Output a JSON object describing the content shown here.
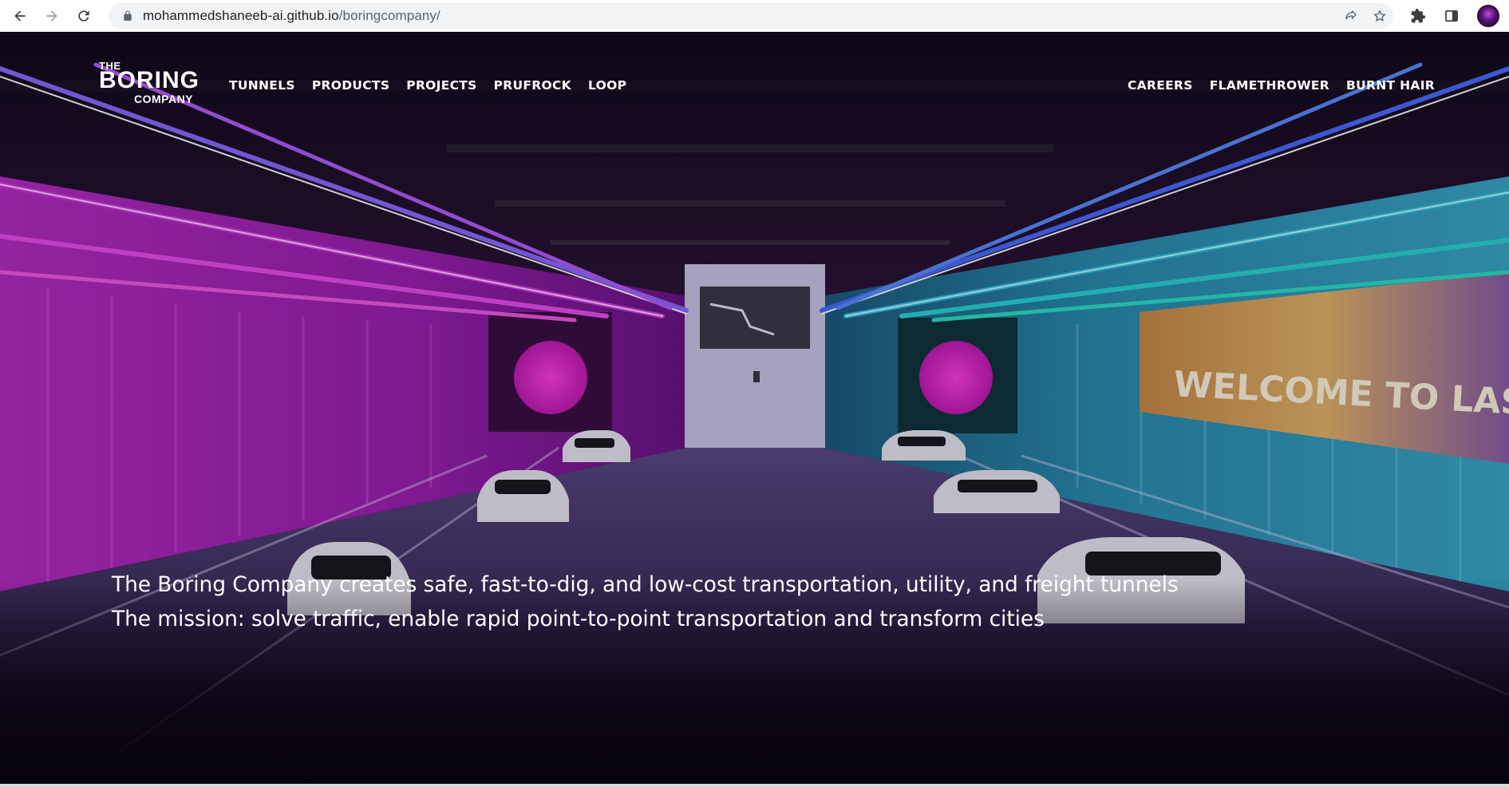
{
  "browser": {
    "url_host": "mohammedshaneeb-ai.github.io",
    "url_path": "/boringcompany/",
    "icons": [
      "back-arrow-icon",
      "forward-arrow-icon",
      "reload-icon",
      "lock-icon",
      "share-icon",
      "star-icon",
      "extensions-icon",
      "side-panel-icon"
    ]
  },
  "logo": {
    "the": "THE",
    "boring": "BORING",
    "company": "COMPANY"
  },
  "nav": {
    "left": [
      "TUNNELS",
      "PRODUCTS",
      "PROJECTS",
      "PRUFROCK",
      "LOOP"
    ],
    "right": [
      "CAREERS",
      "FLAMETHROWER",
      "BURNT HAIR"
    ]
  },
  "hero": {
    "line1": "The Boring Company creates safe, fast-to-dig, and low-cost transportation, utility, and freight tunnels",
    "line2": "The mission: solve traffic, enable rapid point-to-point transportation and transform cities",
    "sign_text": "WELCOME TO LAS VEG"
  },
  "colors": {
    "magenta": "#d238e6",
    "cyan": "#2bc3e8",
    "blue_neon": "#4a6bff",
    "floor": "#3b2b5c"
  }
}
